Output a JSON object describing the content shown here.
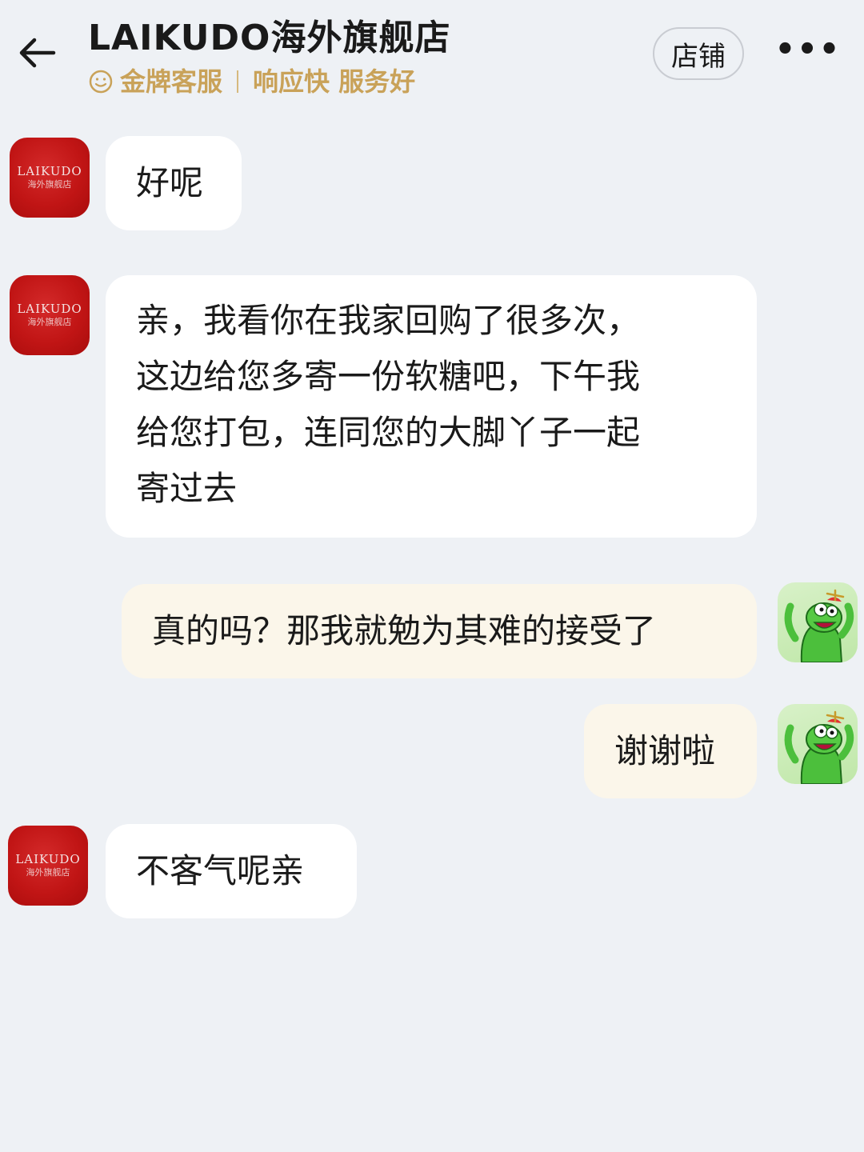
{
  "header": {
    "title": "LAIKUDO海外旗舰店",
    "badge_text": "金牌客服",
    "service_text": "响应快 服务好",
    "shop_button": "店铺",
    "more_button": "•••"
  },
  "messages": [
    {
      "from": "shop",
      "text": "好呢"
    },
    {
      "from": "shop",
      "lines": [
        "亲，我看你在我家回购了很多次，",
        "这边给您多寄一份软糖吧，下午我",
        "给您打包，连同您的大脚丫子一起",
        "寄过去"
      ]
    },
    {
      "from": "user",
      "text": "真的吗？那我就勉为其难的接受了"
    },
    {
      "from": "user",
      "text": "谢谢啦"
    },
    {
      "from": "shop",
      "text": "不客气呢亲"
    }
  ],
  "shop_avatar": {
    "brand": "LAIKUDO",
    "sub": "海外旗舰店"
  },
  "colors": {
    "background": "#eef1f5",
    "incoming_bubble": "#ffffff",
    "outgoing_bubble": "#fbf6ea",
    "gold": "#c9a259",
    "shop_avatar_red": "#c11515",
    "user_avatar_green": "#bfe7a8"
  },
  "icons": {
    "back": "arrow-left-icon",
    "badge": "smile-face-icon",
    "user_avatar": "green-cartoon-frog-icon"
  }
}
